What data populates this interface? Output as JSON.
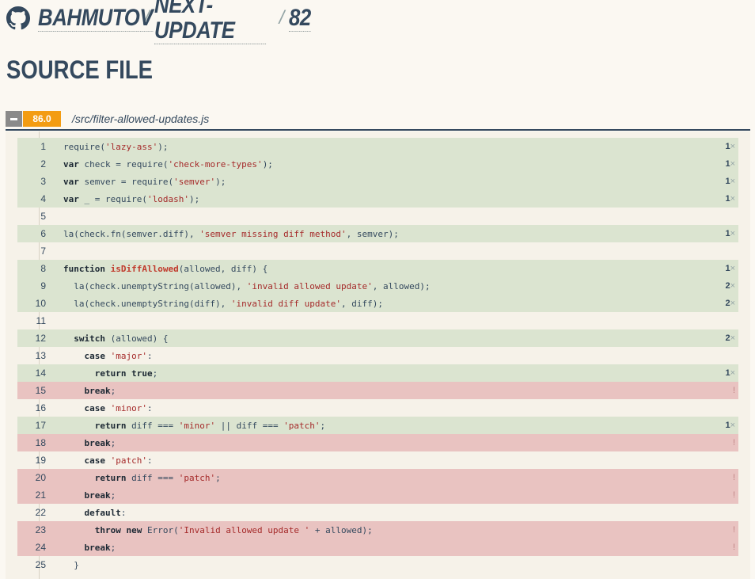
{
  "breadcrumb": {
    "owner": "BAHMUTOV",
    "repo": "NEXT-UPDATE",
    "build": "82",
    "separator": "/"
  },
  "page_title": "SOURCE FILE",
  "file": {
    "score": "86.0",
    "path": "/src/filter-allowed-updates.js"
  },
  "colors": {
    "covered": "#dbe4d0",
    "uncovered": "#e9c3c1",
    "score": "#f39c12",
    "text": "#34495e"
  },
  "lines": [
    {
      "n": "1",
      "status": "covered",
      "hits": "1",
      "tokens": [
        [
          "",
          "require("
        ],
        [
          "str",
          "'lazy-ass'"
        ],
        [
          "",
          ");"
        ]
      ]
    },
    {
      "n": "2",
      "status": "covered",
      "hits": "1",
      "tokens": [
        [
          "kw",
          "var"
        ],
        [
          "",
          " check = require("
        ],
        [
          "str",
          "'check-more-types'"
        ],
        [
          "",
          ");"
        ]
      ]
    },
    {
      "n": "3",
      "status": "covered",
      "hits": "1",
      "tokens": [
        [
          "kw",
          "var"
        ],
        [
          "",
          " semver = require("
        ],
        [
          "str",
          "'semver'"
        ],
        [
          "",
          ");"
        ]
      ]
    },
    {
      "n": "4",
      "status": "covered",
      "hits": "1",
      "tokens": [
        [
          "kw",
          "var"
        ],
        [
          "",
          " _ = require("
        ],
        [
          "str",
          "'lodash'"
        ],
        [
          "",
          ");"
        ]
      ]
    },
    {
      "n": "5",
      "status": "none",
      "hits": "",
      "tokens": []
    },
    {
      "n": "6",
      "status": "covered",
      "hits": "1",
      "tokens": [
        [
          "",
          "la(check.fn(semver.diff), "
        ],
        [
          "str",
          "'semver missing diff method'"
        ],
        [
          "",
          ", semver);"
        ]
      ]
    },
    {
      "n": "7",
      "status": "none",
      "hits": "",
      "tokens": []
    },
    {
      "n": "8",
      "status": "covered",
      "hits": "1",
      "tokens": [
        [
          "kw",
          "function"
        ],
        [
          "",
          " "
        ],
        [
          "fn",
          "isDiffAllowed"
        ],
        [
          "",
          "(allowed, diff) {"
        ]
      ]
    },
    {
      "n": "9",
      "status": "covered",
      "hits": "2",
      "tokens": [
        [
          "",
          "  la(check.unemptyString(allowed), "
        ],
        [
          "str",
          "'invalid allowed update'"
        ],
        [
          "",
          ", allowed);"
        ]
      ]
    },
    {
      "n": "10",
      "status": "covered",
      "hits": "2",
      "tokens": [
        [
          "",
          "  la(check.unemptyString(diff), "
        ],
        [
          "str",
          "'invalid diff update'"
        ],
        [
          "",
          ", diff);"
        ]
      ]
    },
    {
      "n": "11",
      "status": "none",
      "hits": "",
      "tokens": []
    },
    {
      "n": "12",
      "status": "covered",
      "hits": "2",
      "tokens": [
        [
          "",
          "  "
        ],
        [
          "kw",
          "switch"
        ],
        [
          "",
          " (allowed) {"
        ]
      ]
    },
    {
      "n": "13",
      "status": "none",
      "hits": "",
      "tokens": [
        [
          "",
          "    "
        ],
        [
          "kw",
          "case"
        ],
        [
          "",
          " "
        ],
        [
          "str",
          "'major'"
        ],
        [
          "",
          ":"
        ]
      ]
    },
    {
      "n": "14",
      "status": "covered",
      "hits": "1",
      "tokens": [
        [
          "",
          "      "
        ],
        [
          "kw",
          "return true"
        ],
        [
          "",
          ";"
        ]
      ]
    },
    {
      "n": "15",
      "status": "uncovered",
      "hits": "!",
      "tokens": [
        [
          "",
          "    "
        ],
        [
          "kw",
          "break"
        ],
        [
          "",
          ";"
        ]
      ]
    },
    {
      "n": "16",
      "status": "none",
      "hits": "",
      "tokens": [
        [
          "",
          "    "
        ],
        [
          "kw",
          "case"
        ],
        [
          "",
          " "
        ],
        [
          "str",
          "'minor'"
        ],
        [
          "",
          ":"
        ]
      ]
    },
    {
      "n": "17",
      "status": "covered",
      "hits": "1",
      "tokens": [
        [
          "",
          "      "
        ],
        [
          "kw",
          "return"
        ],
        [
          "",
          " diff === "
        ],
        [
          "str",
          "'minor'"
        ],
        [
          "",
          " || diff === "
        ],
        [
          "str",
          "'patch'"
        ],
        [
          "",
          ";"
        ]
      ]
    },
    {
      "n": "18",
      "status": "uncovered",
      "hits": "!",
      "tokens": [
        [
          "",
          "    "
        ],
        [
          "kw",
          "break"
        ],
        [
          "",
          ";"
        ]
      ]
    },
    {
      "n": "19",
      "status": "none",
      "hits": "",
      "tokens": [
        [
          "",
          "    "
        ],
        [
          "kw",
          "case"
        ],
        [
          "",
          " "
        ],
        [
          "str",
          "'patch'"
        ],
        [
          "",
          ":"
        ]
      ]
    },
    {
      "n": "20",
      "status": "uncovered",
      "hits": "!",
      "tokens": [
        [
          "",
          "      "
        ],
        [
          "kw",
          "return"
        ],
        [
          "",
          " diff === "
        ],
        [
          "str",
          "'patch'"
        ],
        [
          "",
          ";"
        ]
      ]
    },
    {
      "n": "21",
      "status": "uncovered",
      "hits": "!",
      "tokens": [
        [
          "",
          "    "
        ],
        [
          "kw",
          "break"
        ],
        [
          "",
          ";"
        ]
      ]
    },
    {
      "n": "22",
      "status": "none",
      "hits": "",
      "tokens": [
        [
          "",
          "    "
        ],
        [
          "kw",
          "default"
        ],
        [
          "",
          ":"
        ]
      ]
    },
    {
      "n": "23",
      "status": "uncovered",
      "hits": "!",
      "tokens": [
        [
          "",
          "      "
        ],
        [
          "kw",
          "throw new"
        ],
        [
          "",
          " Error("
        ],
        [
          "str",
          "'Invalid allowed update '"
        ],
        [
          "",
          " + allowed);"
        ]
      ]
    },
    {
      "n": "24",
      "status": "uncovered",
      "hits": "!",
      "tokens": [
        [
          "",
          "    "
        ],
        [
          "kw",
          "break"
        ],
        [
          "",
          ";"
        ]
      ]
    },
    {
      "n": "25",
      "status": "none",
      "hits": "",
      "tokens": [
        [
          "",
          "  }"
        ]
      ]
    }
  ]
}
